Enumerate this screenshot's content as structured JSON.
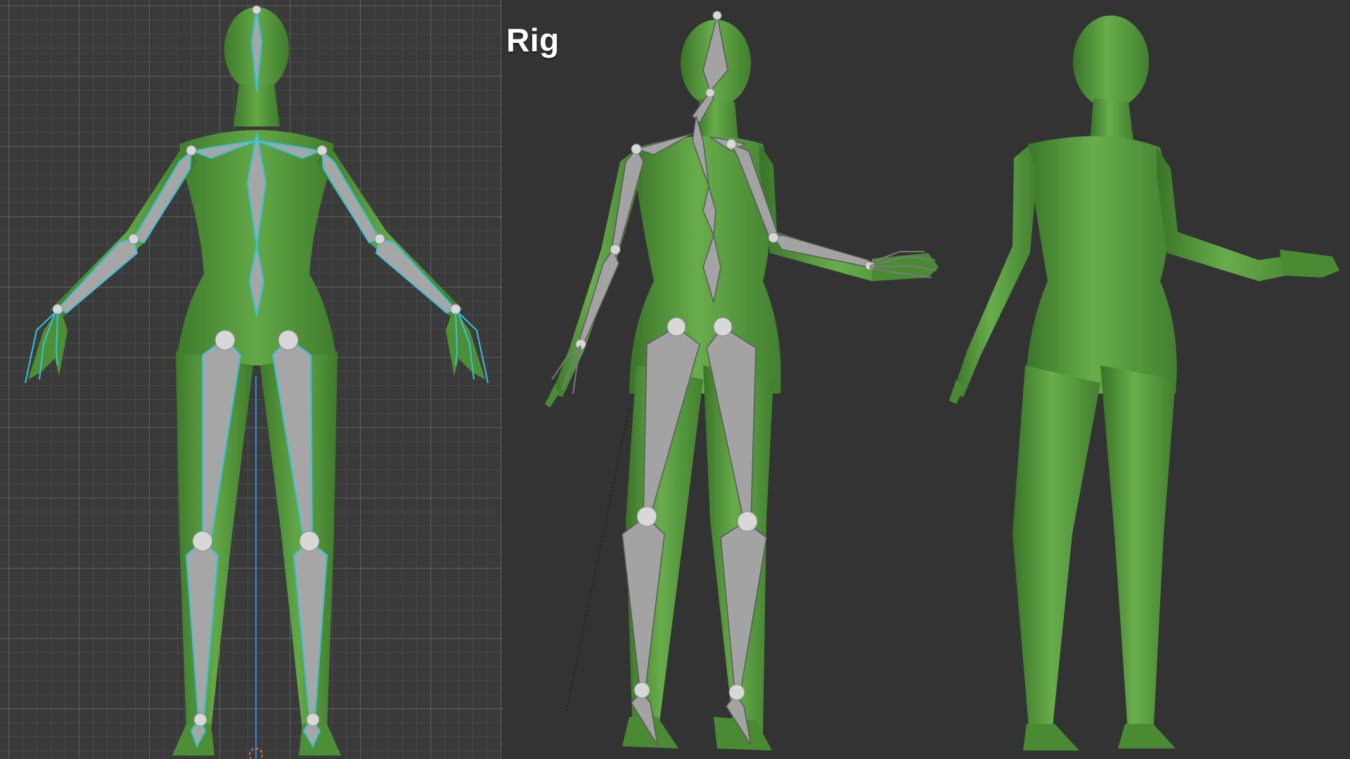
{
  "header": {
    "label": "Rig"
  },
  "colors": {
    "background": "#333333",
    "grid_background": "#3a3a3a",
    "mesh": "#5c9e3f",
    "mesh_shadow": "#3f7a2b",
    "bone": "#a0a0a0",
    "bone_outline": "#5a5a5a",
    "selection": "#37c2de",
    "joint": "#d8d8d8"
  },
  "icons": {
    "origin": "origin-marker-icon"
  }
}
